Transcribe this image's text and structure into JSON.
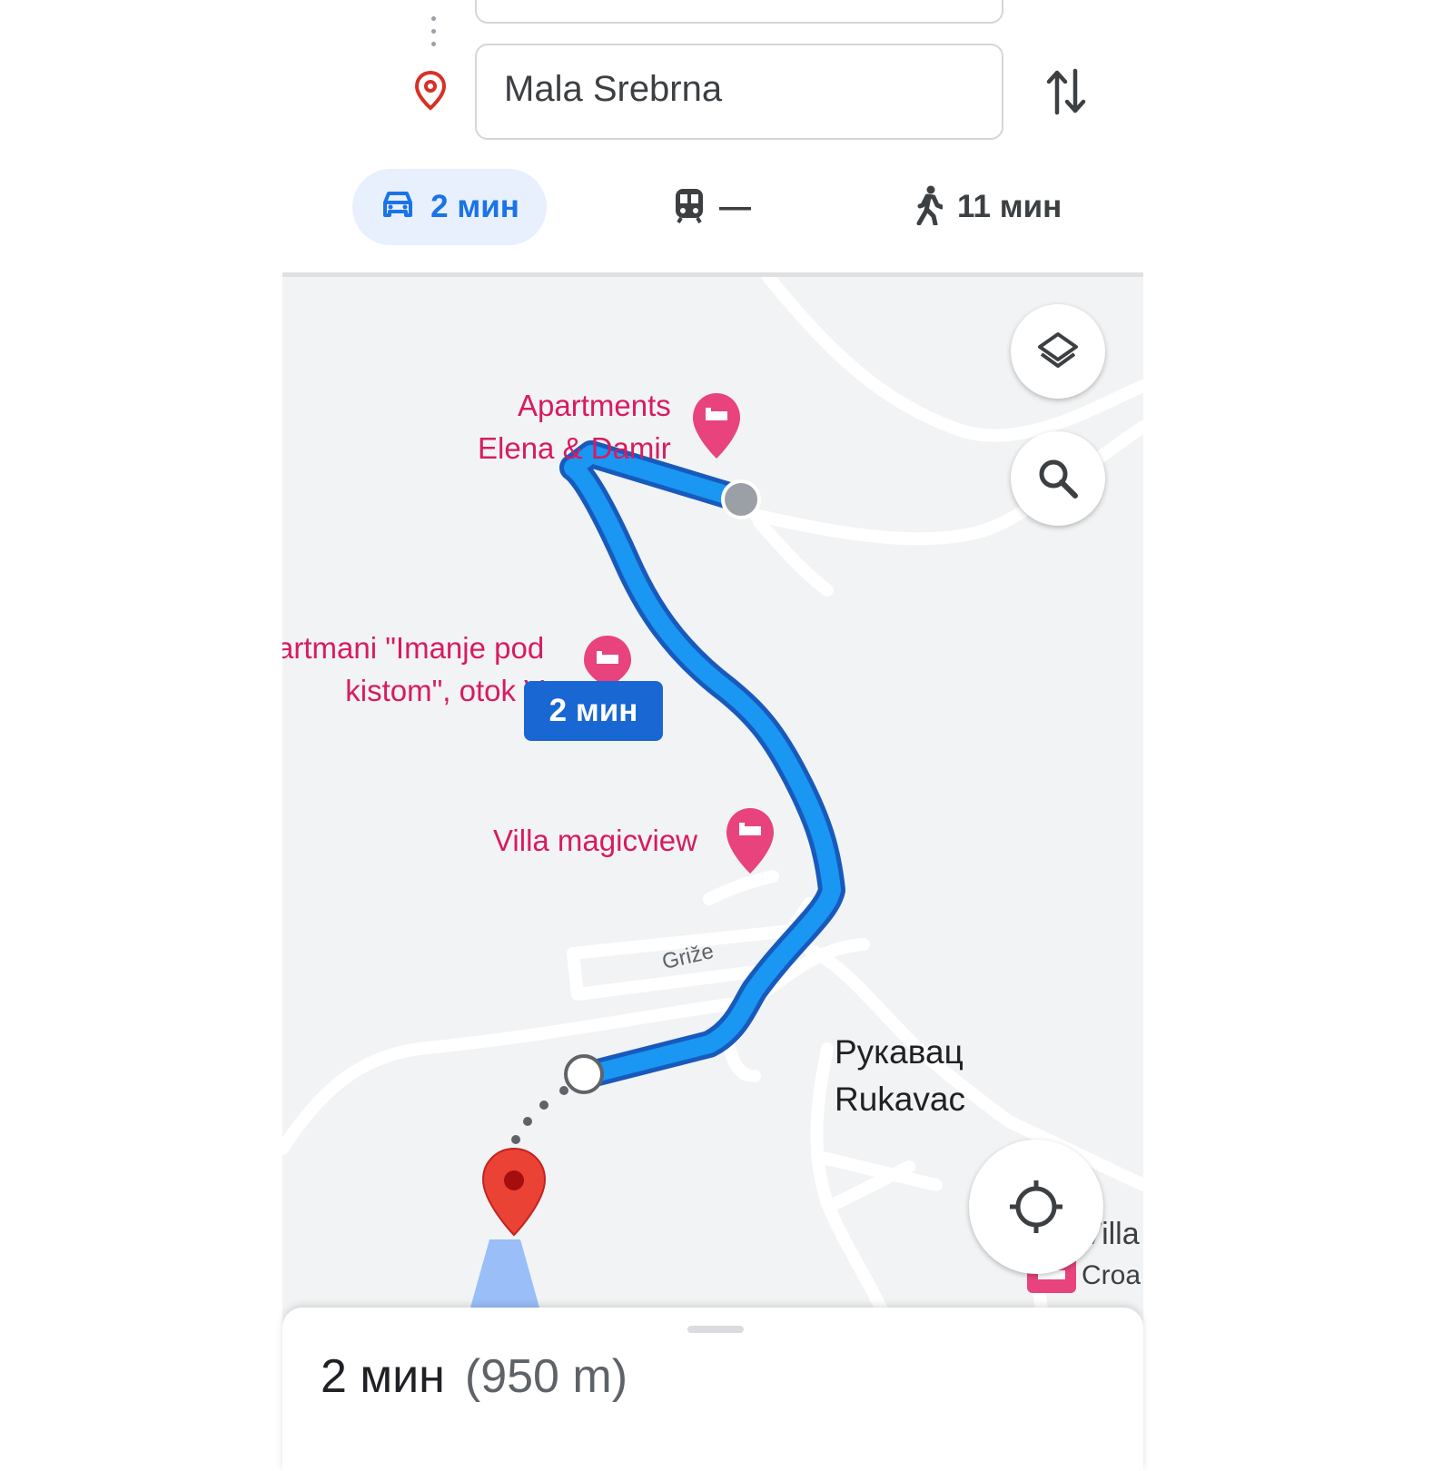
{
  "directions": {
    "origin_value": "",
    "destination_value": "Mala Srebrna"
  },
  "modes": {
    "drive": {
      "label": "2 мин"
    },
    "transit": {
      "label": "—"
    },
    "walk": {
      "label": "11 мин"
    }
  },
  "map": {
    "pois": [
      {
        "line1": "Apartments",
        "line2": "Elena & Damir"
      },
      {
        "line1": "artmani \"Imanje pod",
        "line2": "kistom\", otok V"
      },
      {
        "line1": "Villa magicview"
      }
    ],
    "street_label": "Griže",
    "town_label": {
      "line1": "Рукавац",
      "line2": "Rukavac"
    },
    "route_time_label": "2 мин",
    "edge_labels": {
      "villa": "Villa",
      "croa": "Croa"
    },
    "colors": {
      "route": "#1a73e8",
      "poi": "#e8437c",
      "destination_pin": "#ea4335"
    }
  },
  "summary": {
    "time": "2 мин",
    "distance": "(950 m)"
  },
  "icons": [
    "destination-pin-icon",
    "swap-icon",
    "car-icon",
    "transit-icon",
    "walk-icon",
    "layers-icon",
    "search-icon",
    "my-location-icon",
    "hotel-icon"
  ]
}
